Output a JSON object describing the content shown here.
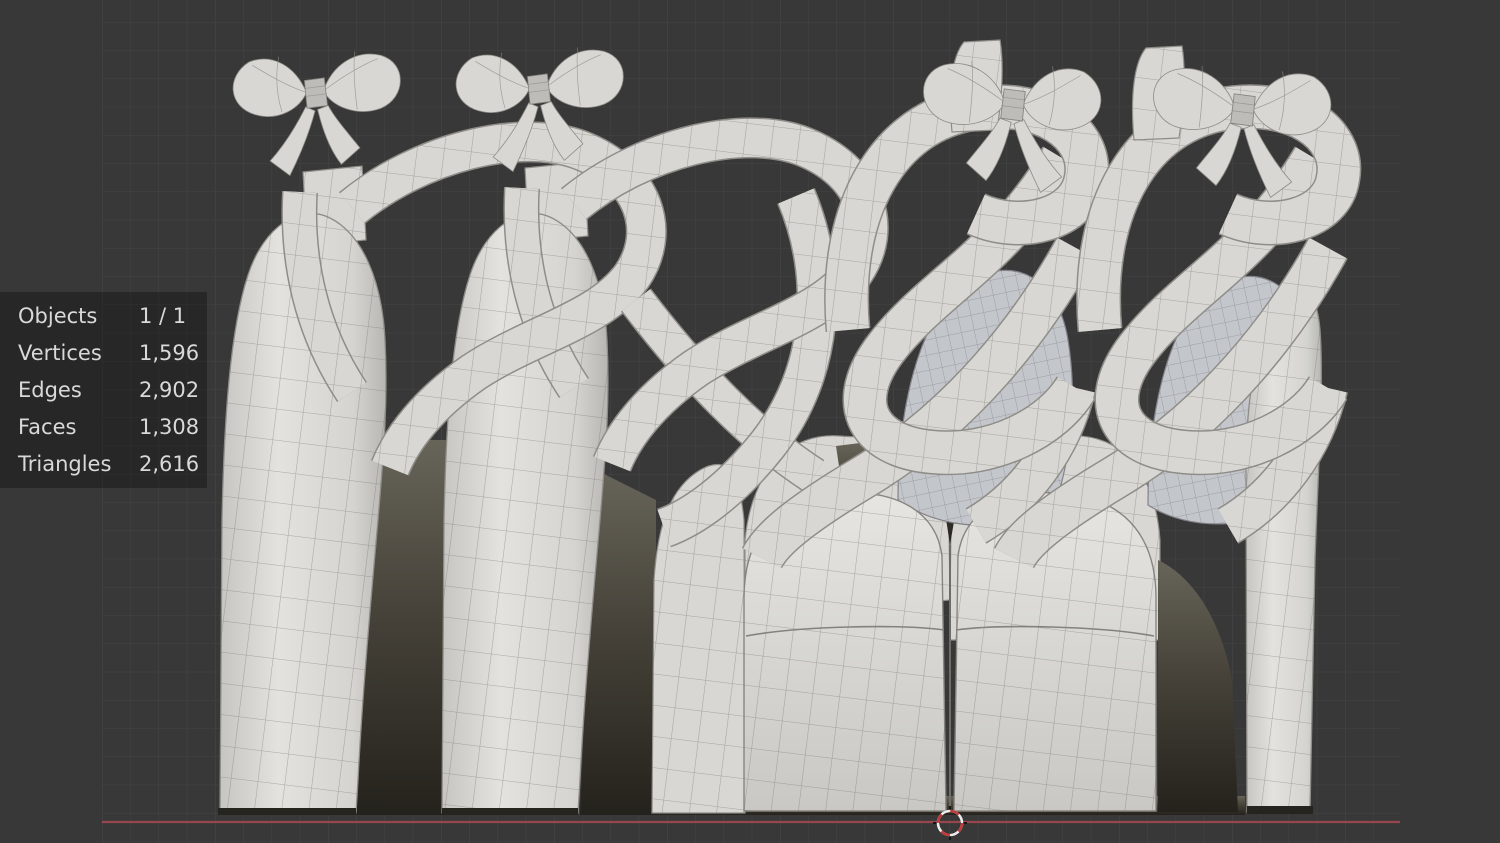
{
  "app": {
    "name": "3D viewport",
    "view": "front orthographic"
  },
  "stats": {
    "rows": [
      {
        "label": "Objects",
        "value": "1 / 1"
      },
      {
        "label": "Vertices",
        "value": "1,596"
      },
      {
        "label": "Edges",
        "value": "2,902"
      },
      {
        "label": "Faces",
        "value": "1,308"
      },
      {
        "label": "Triangles",
        "value": "2,616"
      }
    ]
  },
  "colors": {
    "background": "#383838",
    "grid_line": "#454545",
    "x_axis": "#97464d",
    "stats_text": "#d9d9d9",
    "shoe_light": "#d9d8d4",
    "shoe_edge": "#8f8d88",
    "shoe_interior_shadow": "#443f33",
    "strap_blue_tint": "#c3c6cb",
    "cursor_red": "#c23a3a",
    "cursor_white": "#ececec"
  },
  "model": {
    "description": "pair of platform high-heel shoes with spiral ribbon straps and bows, white clay material with wireframe overlay"
  }
}
